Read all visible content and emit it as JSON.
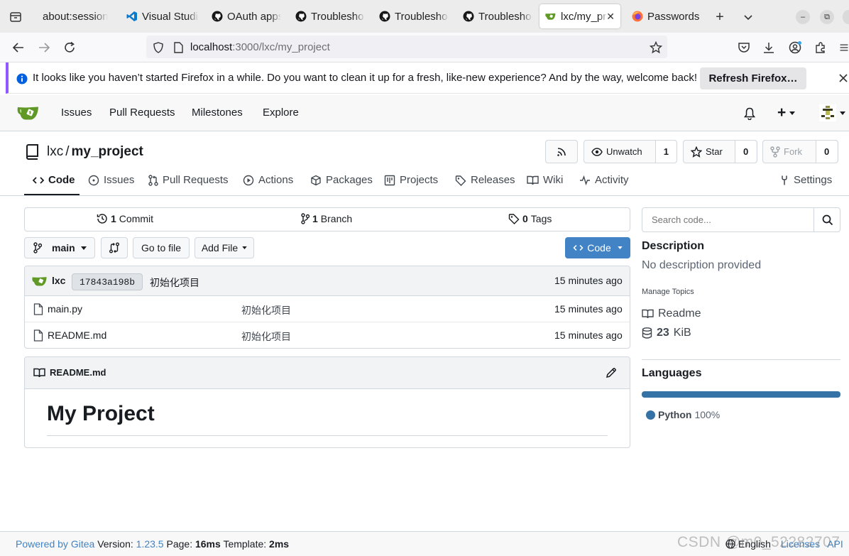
{
  "browser": {
    "tabs": [
      {
        "title": "about:sessionrestore",
        "icon": "firefox-tab-icon",
        "active": false
      },
      {
        "title": "Visual Studio Code",
        "icon": "vscode-icon",
        "active": false
      },
      {
        "title": "OAuth apps",
        "icon": "github-icon",
        "active": false
      },
      {
        "title": "Troubleshooting",
        "icon": "github-icon",
        "active": false
      },
      {
        "title": "Troubleshooting",
        "icon": "github-icon",
        "active": false
      },
      {
        "title": "Troubleshooting",
        "icon": "github-icon",
        "active": false
      },
      {
        "title": "lxc/my_project",
        "icon": "gitea-icon",
        "active": true
      },
      {
        "title": "Passwords",
        "icon": "firefox-icon",
        "active": false
      }
    ],
    "url": {
      "host": "localhost",
      "rest": ":3000/lxc/my_project"
    },
    "notification": {
      "text": "It looks like you haven’t started Firefox in a while. Do you want to clean it up for a fresh, like-new experience? And by the way, welcome back!",
      "button": "Refresh Firefox…"
    }
  },
  "nav": {
    "items": [
      "Issues",
      "Pull Requests",
      "Milestones",
      "Explore"
    ],
    "plus": "+"
  },
  "repo": {
    "owner": "lxc",
    "sep": "/",
    "name": "my_project",
    "unwatch_label": "Unwatch",
    "watch_count": "1",
    "star_label": "Star",
    "star_count": "0",
    "fork_label": "Fork",
    "fork_count": "0"
  },
  "repo_tabs": [
    "Code",
    "Issues",
    "Pull Requests",
    "Actions",
    "Packages",
    "Projects",
    "Releases",
    "Wiki",
    "Activity",
    "Settings"
  ],
  "stats": {
    "commits_num": "1",
    "commits_label": "Commit",
    "branches_num": "1",
    "branches_label": "Branch",
    "tags_num": "0",
    "tags_label": "Tags"
  },
  "toolbar": {
    "branch": "main",
    "go_to_file": "Go to file",
    "add_file": "Add File",
    "code": "Code"
  },
  "latest_commit": {
    "author": "lxc",
    "sha": "17843a198b",
    "message": "初始化项目",
    "time": "15 minutes ago"
  },
  "files": [
    {
      "name": "main.py",
      "message": "初始化项目",
      "time": "15 minutes ago"
    },
    {
      "name": "README.md",
      "message": "初始化项目",
      "time": "15 minutes ago"
    }
  ],
  "readme": {
    "filename": "README.md",
    "heading": "My Project"
  },
  "sidebar": {
    "search_placeholder": "Search code...",
    "description_title": "Description",
    "description": "No description provided",
    "manage_topics": "Manage Topics",
    "readme_link": "Readme",
    "size_num": "23",
    "size_unit": "KiB",
    "languages_title": "Languages",
    "language_name": "Python",
    "language_pct": "100%",
    "language_color": "#3572a5"
  },
  "footer": {
    "powered": "Powered by Gitea",
    "version_label": "Version:",
    "version": "1.23.5",
    "page_label": "Page:",
    "page_time": "16ms",
    "template_label": "Template:",
    "template_time": "2ms",
    "language": "English",
    "licenses": "Licenses",
    "api": "API"
  },
  "watermark": "CSDN @m0_52282707"
}
